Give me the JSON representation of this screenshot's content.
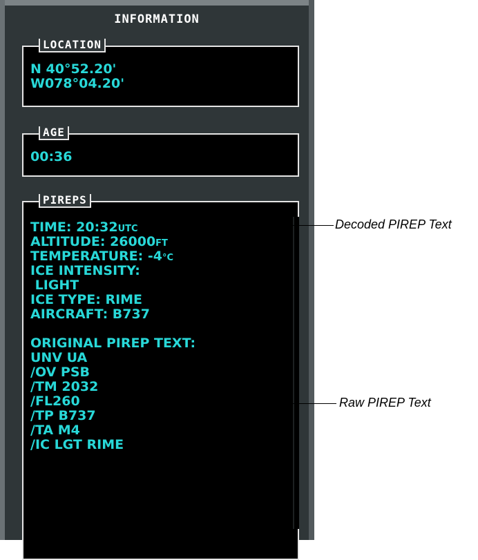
{
  "panel": {
    "title": "INFORMATION",
    "location": {
      "label": "LOCATION",
      "lat": "N 40°52.20'",
      "lon": "W078°04.20'"
    },
    "age": {
      "label": "AGE",
      "value": "00:36"
    },
    "pireps": {
      "label": "PIREPS",
      "time_label": "TIME: ",
      "time_value": "20:32",
      "time_unit": "UTC",
      "altitude_label": "ALTITUDE: ",
      "altitude_value": "26000",
      "altitude_unit": "FT",
      "temperature_label": "TEMPERATURE: ",
      "temperature_value": "-4",
      "temperature_unit": "°C",
      "ice_intensity_label": "ICE INTENSITY:",
      "ice_intensity_value": " LIGHT",
      "ice_type": "ICE TYPE: RIME",
      "aircraft": "AIRCRAFT: B737",
      "original_header": "ORIGINAL PIREP TEXT:",
      "raw_lines": [
        "UNV UA",
        "/OV PSB",
        "/TM 2032",
        "/FL260",
        "/TP B737",
        "/TA M4",
        "/IC LGT RIME"
      ]
    }
  },
  "callouts": {
    "decoded": "Decoded PIREP Text",
    "raw": "Raw PIREP Text"
  },
  "colors": {
    "panel_bg": "#2f3638",
    "text_cyan": "#28d8d8",
    "border": "#e6e6e6"
  }
}
